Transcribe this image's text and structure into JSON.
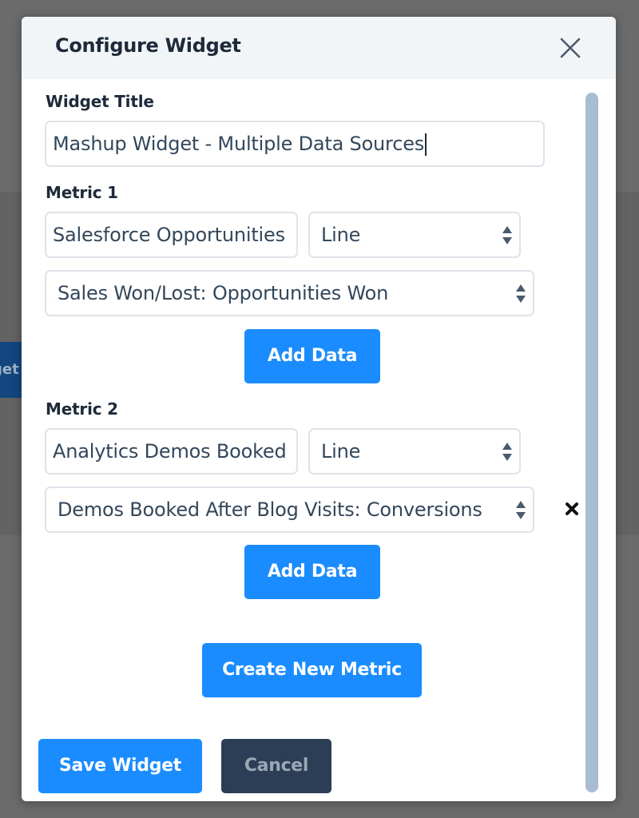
{
  "background": {
    "partial_button_text": "get"
  },
  "modal": {
    "title": "Configure Widget",
    "widget_title_label": "Widget Title",
    "widget_title_value": "Mashup Widget - Multiple Data Sources",
    "metrics": [
      {
        "label": "Metric 1",
        "source_value": "Salesforce Opportunities",
        "chart_type": "Line",
        "data_select": "Sales Won/Lost: Opportunities Won",
        "add_data_label": "Add Data"
      },
      {
        "label": "Metric 2",
        "source_value": "Analytics Demos Booked",
        "chart_type": "Line",
        "data_select": "Demos Booked After Blog Visits: Conversions",
        "add_data_label": "Add Data"
      }
    ],
    "create_metric_label": "Create New Metric",
    "save_label": "Save Widget",
    "cancel_label": "Cancel"
  },
  "colors": {
    "primary": "#1a8cff",
    "dark_button": "#2c3e55",
    "header_bg": "#f2f5f8",
    "text": "#1e2a3a",
    "scrollbar": "#a8bcd2"
  },
  "icons": {
    "close": "close-icon",
    "select": "select-arrows-icon",
    "remove": "remove-x-icon"
  }
}
